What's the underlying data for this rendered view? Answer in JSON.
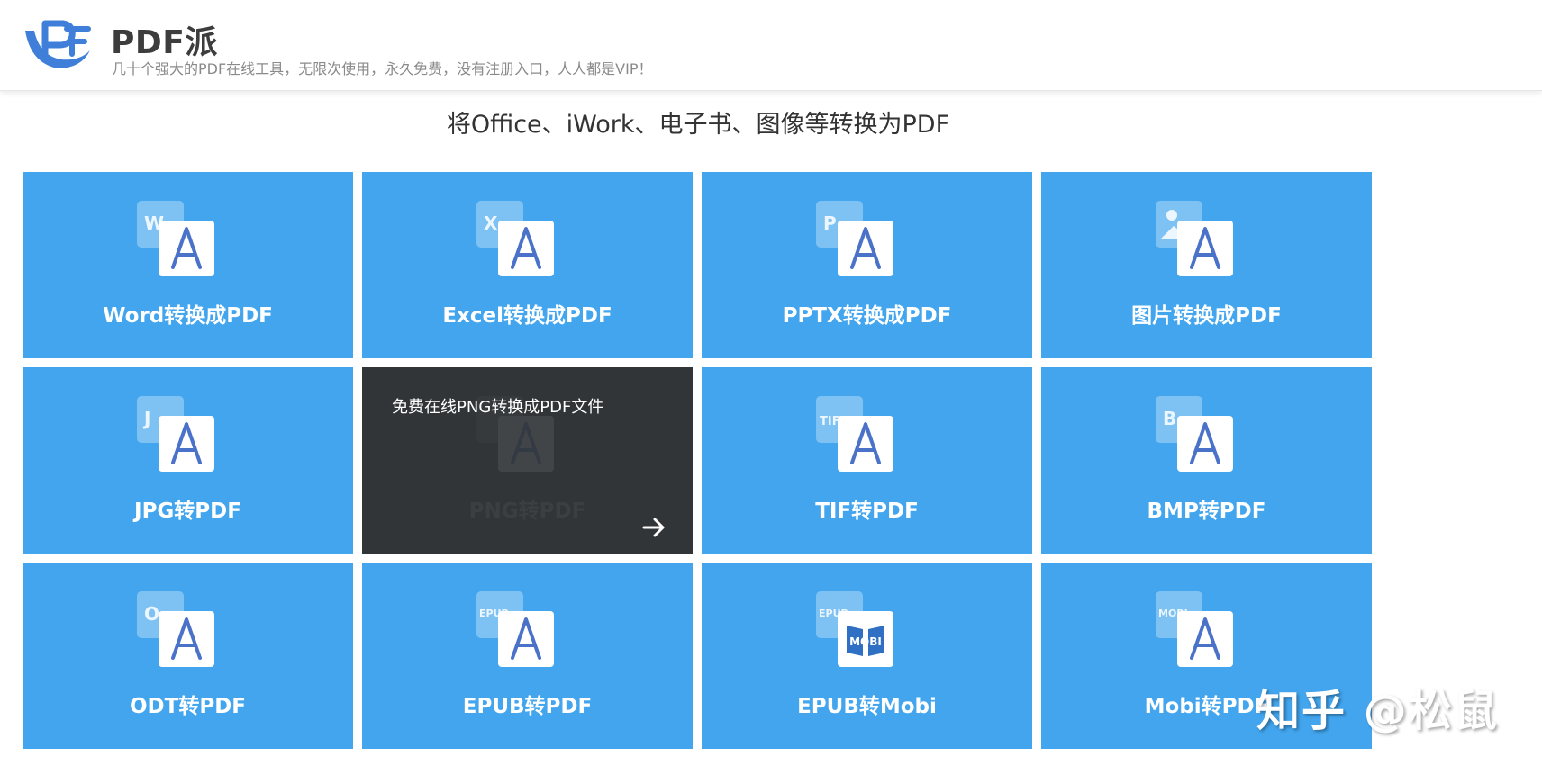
{
  "header": {
    "brand_name": "PDF派",
    "slogan": "几十个强大的PDF在线工具，无限次使用，永久免费，没有注册入口，人人都是VIP！",
    "logo_icon": "pdfpai-logo-icon"
  },
  "section": {
    "title": "将Office、iWork、电子书、图像等转换为PDF"
  },
  "tiles": [
    {
      "label": "Word转换成PDF",
      "badge": "W",
      "icon": "word-to-pdf-icon"
    },
    {
      "label": "Excel转换成PDF",
      "badge": "X",
      "icon": "excel-to-pdf-icon"
    },
    {
      "label": "PPTX转换成PDF",
      "badge": "P",
      "icon": "pptx-to-pdf-icon"
    },
    {
      "label": "图片转换成PDF",
      "badge": "",
      "icon": "image-to-pdf-icon"
    },
    {
      "label": "JPG转PDF",
      "badge": "J",
      "icon": "jpg-to-pdf-icon"
    },
    {
      "label": "PNG转PDF",
      "badge": "",
      "icon": "png-to-pdf-icon",
      "hover_text": "免费在线PNG转换成PDF文件"
    },
    {
      "label": "TIF转PDF",
      "badge": "TIF",
      "icon": "tif-to-pdf-icon"
    },
    {
      "label": "BMP转PDF",
      "badge": "B",
      "icon": "bmp-to-pdf-icon"
    },
    {
      "label": "ODT转PDF",
      "badge": "O",
      "icon": "odt-to-pdf-icon"
    },
    {
      "label": "EPUB转PDF",
      "badge": "EPUB",
      "icon": "epub-to-pdf-icon"
    },
    {
      "label": "EPUB转Mobi",
      "badge": "EPUB",
      "icon": "epub-to-mobi-icon",
      "front_text": "MOBI"
    },
    {
      "label": "Mobi转PDF",
      "badge": "MOBI",
      "icon": "mobi-to-pdf-icon"
    }
  ],
  "watermark": {
    "text": "知乎 @松鼠"
  },
  "colors": {
    "tile": "#42a5ee",
    "tile_hover": "#323538",
    "brand": "#3f7fd9"
  }
}
